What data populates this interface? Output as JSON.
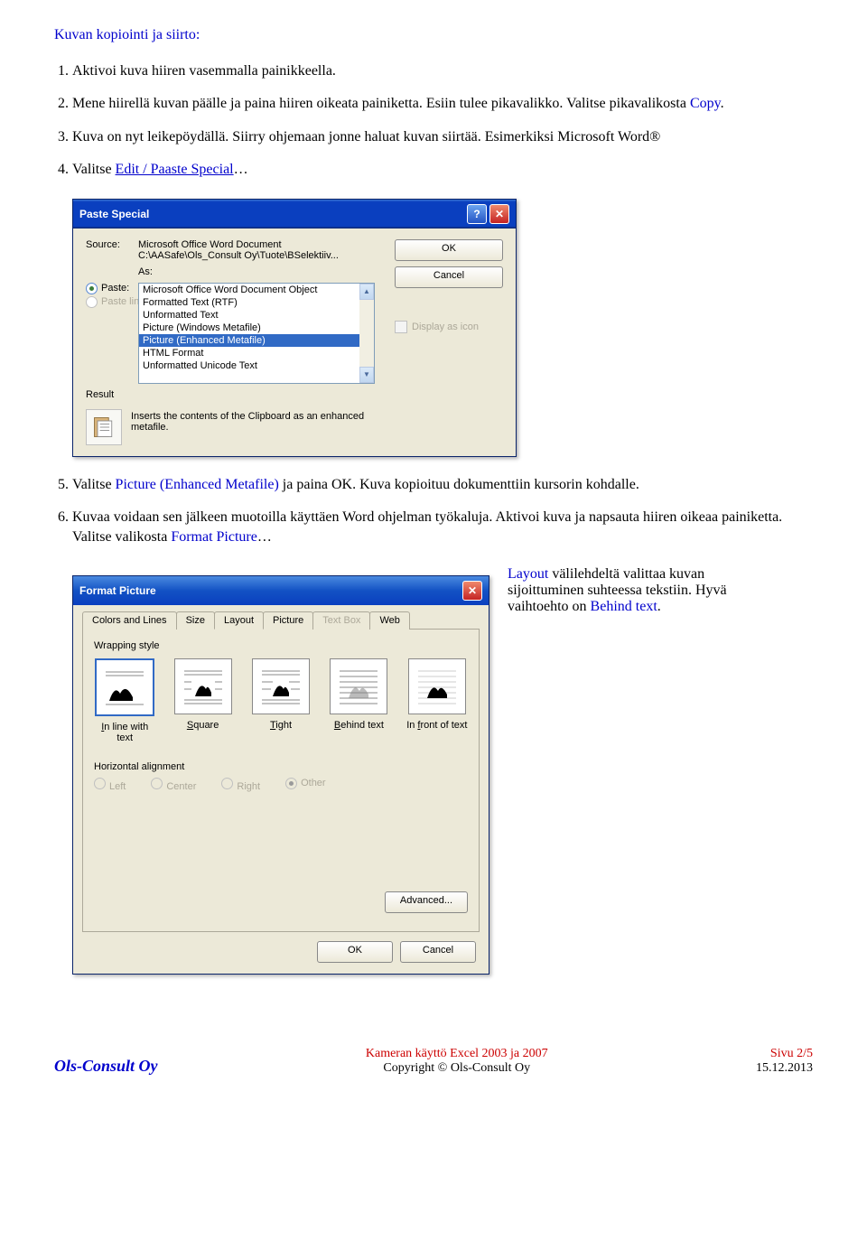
{
  "heading": "Kuvan kopiointi ja siirto:",
  "steps": {
    "s1": "Aktivoi kuva hiiren vasemmalla painikkeella.",
    "s2a": "Mene hiirellä kuvan päälle ja paina hiiren oikeata painiketta. Esiin tulee pikavalikko. Valitse pikavalikosta ",
    "s2b": "Copy",
    "s2c": ".",
    "s3": "Kuva on nyt leikepöydällä. Siirry ohjemaan jonne haluat kuvan siirtää. Esimerkiksi Microsoft Word®",
    "s4a": "Valitse ",
    "s4b": "Edit / Paaste Special",
    "s4c": "…",
    "s5a": "Valitse ",
    "s5b": "Picture (Enhanced Metafile)",
    "s5c": " ja paina OK. Kuva kopioituu dokumenttiin kursorin kohdalle.",
    "s6a": "Kuvaa voidaan sen jälkeen muotoilla käyttäen Word ohjelman työkaluja. Aktivoi kuva ja napsauta hiiren oikeaa painiketta. Valitse valikosta ",
    "s6b": "Format Picture",
    "s6c": "…"
  },
  "pasteSpecial": {
    "title": "Paste Special",
    "sourceLabel": "Source:",
    "sourceLine1": "Microsoft Office Word Document",
    "sourceLine2": "C:\\AASafe\\Ols_Consult Oy\\Tuote\\BSelektiiv...",
    "asLabel": "As:",
    "pasteLabel": "Paste:",
    "pasteLinkLabel": "Paste link:",
    "items": [
      "Microsoft Office Word Document Object",
      "Formatted Text (RTF)",
      "Unformatted Text",
      "Picture (Windows Metafile)",
      "Picture (Enhanced Metafile)",
      "HTML Format",
      "Unformatted Unicode Text"
    ],
    "selectedIndex": 4,
    "ok": "OK",
    "cancel": "Cancel",
    "displayAsIcon": "Display as icon",
    "resultLabel": "Result",
    "resultText": "Inserts the contents of the Clipboard as an enhanced metafile."
  },
  "formatPicture": {
    "title": "Format Picture",
    "tabs": [
      "Colors and Lines",
      "Size",
      "Layout",
      "Picture",
      "Text Box",
      "Web"
    ],
    "activeTab": 2,
    "disabledTab": 4,
    "wrappingLabel": "Wrapping style",
    "wrapItems": [
      "In line with text",
      "Square",
      "Tight",
      "Behind text",
      "In front of text"
    ],
    "wrapUnderline": [
      "I",
      "S",
      "T",
      "B",
      "F"
    ],
    "selectedWrap": 0,
    "horizLabel": "Horizontal alignment",
    "horizItems": [
      "Left",
      "Center",
      "Right",
      "Other"
    ],
    "horizSelected": 3,
    "advanced": "Advanced...",
    "ok": "OK",
    "cancel": "Cancel"
  },
  "sideNote": {
    "line1a": "Layout",
    "line1b": " välilehdeltä valittaa kuvan sijoittuminen suhteessa tekstiin. Hyvä vaihtoehto on ",
    "line1c": "Behind text",
    "line1d": "."
  },
  "footer": {
    "company": "Ols-Consult Oy",
    "centerLine1": "Kameran käyttö Excel 2003 ja 2007",
    "centerLine2": "Copyright © Ols-Consult Oy",
    "right1": "Sivu 2/5",
    "right2": "15.12.2013"
  }
}
